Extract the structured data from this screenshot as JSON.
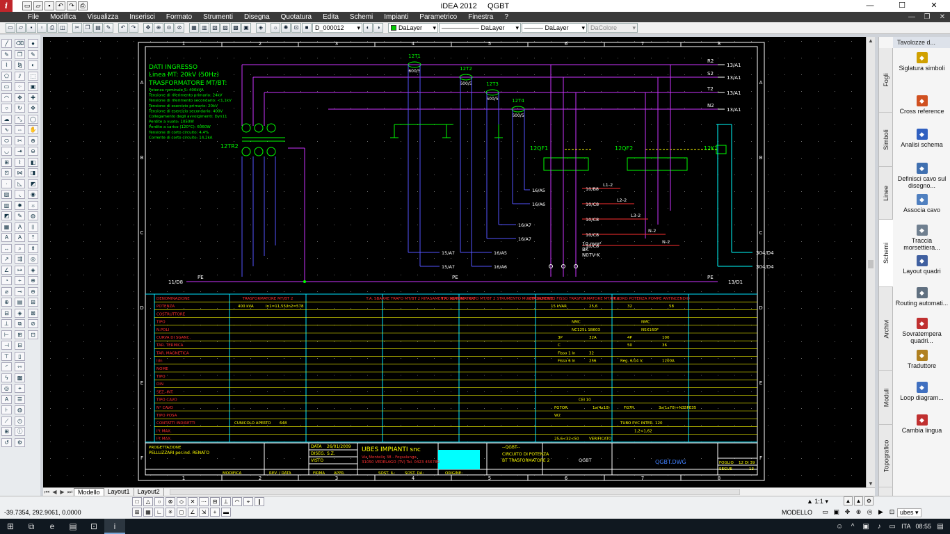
{
  "window": {
    "app_title": "iDEA 2012",
    "doc_title": "QGBT"
  },
  "menu": [
    "File",
    "Modifica",
    "Visualizza",
    "Inserisci",
    "Formato",
    "Strumenti",
    "Disegna",
    "Quotatura",
    "Edita",
    "Schemi",
    "Impianti",
    "Parametrico",
    "Finestra",
    "?"
  ],
  "toolbar": {
    "view_combo": "D_000012",
    "layer_combo": "DaLayer",
    "linetype_combo": "DaLayer",
    "lineweight_combo": "DaLayer",
    "color_combo": "DaColore",
    "accent_color": "#00c800"
  },
  "right_panel": {
    "header": "Tavolozze d...",
    "vertical_tabs": [
      "Fogli",
      "Simboli",
      "Linee",
      "Schemi",
      "Archivi",
      "Moduli",
      "Topografico"
    ],
    "active_tab": "Schemi",
    "tools": [
      {
        "label": "Siglatura simboli",
        "icon": "tag-icon"
      },
      {
        "label": "Cross reference",
        "icon": "cross-reference-icon"
      },
      {
        "label": "Analisi schema",
        "icon": "analysis-icon"
      },
      {
        "label": "Definisci cavo sul disegno...",
        "icon": "cable-define-icon"
      },
      {
        "label": "Associa cavo",
        "icon": "cable-associate-icon"
      },
      {
        "label": "Traccia morsettiera...",
        "icon": "terminal-block-icon"
      },
      {
        "label": "Layout quadri",
        "icon": "panel-layout-icon"
      },
      {
        "label": "Routing automati...",
        "icon": "routing-icon"
      },
      {
        "label": "Sovratempera quadri...",
        "icon": "thermometer-icon"
      },
      {
        "label": "Traduttore",
        "icon": "translator-icon"
      },
      {
        "label": "Loop diagram...",
        "icon": "loop-diagram-icon"
      },
      {
        "label": "Cambia lingua",
        "icon": "language-icon"
      }
    ]
  },
  "layout_tabs": [
    "Modello",
    "Layout1",
    "Layout2"
  ],
  "status": {
    "coordinates": "-39.7354, 292.9061, 0.0000",
    "scale": "1:1",
    "mode": "MODELLO",
    "workspace": "ubes"
  },
  "taskbar": {
    "lang": "ITA",
    "time": "08:55"
  },
  "drawing": {
    "grid_columns": [
      "1",
      "2",
      "3",
      "4",
      "5",
      "6",
      "7",
      "8"
    ],
    "grid_rows": [
      "A",
      "B",
      "C",
      "D",
      "E",
      "F"
    ],
    "data_ingresso": {
      "title": "DATI INGRESSO",
      "line": "Linea MT: 20kV (50Hz)",
      "transformer": "TRASFORMATORE MT/BT:",
      "specs": [
        "Potenza nominale S: 400kVA",
        "Tensione di riferimento primario: 24kV",
        "Tensione di riferimento secondario: <1,1kV",
        "Tensione di esercizio primario: 20kV",
        "Tensione di esercizio secondario: 400V",
        "Collegamento degli avvolgimenti: Dyn11",
        "Perdite a vuoto: 1050W",
        "Perdite a carico (120°C): 6060W",
        "Tensione di corto circuito: 4,4%",
        "Corrente di corto circuito: 14,2kA"
      ]
    },
    "bus_labels": [
      "R2",
      "S2",
      "T2",
      "N2"
    ],
    "bus_refs": [
      "13/A1",
      "13/A1",
      "13/A1",
      "13/A1"
    ],
    "ct_labels": [
      "12T1",
      "12T2",
      "12T3",
      "12T4"
    ],
    "ct_ratios": [
      "600/5",
      "600/5",
      "600/5",
      "600/5"
    ],
    "transformer_tag": "12TR2",
    "breaker_tags": [
      "12QF1",
      "12QF2",
      "12K1"
    ],
    "pe_label": "PE",
    "pe_ref_left": "11/D8",
    "pe_ref_right": "13/D1",
    "outgoing_refs": [
      "10/B8",
      "10/C8",
      "10/C8",
      "10/C8",
      "10/C8"
    ],
    "outgoing_lines": [
      "L1-2",
      "L2-2",
      "L3-2",
      "N-2",
      "N-2"
    ],
    "down_refs": [
      "15/A7",
      "15/A7",
      "16/A5",
      "16/A6",
      "16/A7",
      "16/A7",
      "16/A6",
      "16/A5"
    ],
    "right_refs": [
      "304/D4",
      "304/D4"
    ],
    "cable_note": [
      "10 mm²",
      "BK",
      "N07V-K"
    ],
    "table": {
      "row_labels": [
        "DENOMINAZIONE",
        "POTENZA",
        "COSTRUTTORE",
        "TIPO",
        "N.POLI",
        "CURVA DI SGANC.",
        "TAR. TERMICA",
        "TAR. MAGNETICA",
        "Idn",
        "NOME",
        "TIPO",
        "DIN",
        "SEZ.-INT.",
        "TIPO CAVO",
        "N° CAVO",
        "TIPO POSA",
        "CONTATTI INDIRETTI",
        "I²t MAX.",
        "I²t MAX."
      ],
      "col_heads": [
        "TRASFORMATORE MT/BT 2",
        "T.A. SBARRE TRAFO MT/BT 2 RIFASAMENTO AUTOMATICO",
        "T.A. SBARRE TRAFO MT/BT 2 STRUMENTO MULTIFUNZIONE",
        "RIFASAMENTO FISSO TRASFORMATORE MT/BT 2",
        "QUADRO POTENZA POMPE ANTINCENDIO"
      ],
      "values": [
        "400 kVA",
        "In1=11,55/In2=578",
        "15 kVAR",
        "25,6",
        "32",
        "58",
        "NMC",
        "NMC",
        "NC125L 1B603",
        "NSX160F",
        "3P",
        "32A",
        "4P",
        "100",
        "C",
        "50",
        "36",
        "Fisso 1 In",
        "32",
        "Fisso 6 In",
        "256",
        "Reg. 6/14 Ic",
        "1200A",
        "CEI 10",
        "FG7OR",
        "1x(4x10)",
        "FG7R",
        "3x(1x70)+N35PE35",
        "W2",
        "CUNICOLO APERTO",
        "648",
        "TUBO PVC INTER.",
        "120",
        "VERIFICATO",
        "1,2<1,62",
        "25,6<32<50"
      ]
    },
    "title_block": {
      "progettazione": "PROGETTAZIONE",
      "designer": "PELLUZZARI per.ind. RENATO",
      "data_label": "DATA",
      "data_value": "26/01/2009",
      "diseg_label": "DISEG.",
      "diseg_value": "S.Z.",
      "visto_label": "VISTO",
      "company": "UBES IMPIANTI snc",
      "company_addr1": "Via Montello 38 - Fossalunga",
      "company_addr2": "31050 VEDELAGO (TV) Tel. 0423 456789",
      "doc": "--QGBT--",
      "desc1": "CIRCUITO DI POTENZA",
      "desc2": "BT TRASFORMATORE 2",
      "code": "QGBT",
      "file": "QGBT.DWG",
      "foglio_label": "FOGLIO",
      "foglio_value": "12 DI 39",
      "segue_label": "SEGUE",
      "segue_value": "13",
      "rev_labels": [
        "MODIFICA",
        "REV. / DATA",
        "FIRMA",
        "APPR.",
        "SOST. IL:",
        "SOST. DA:",
        "ORIGINE:"
      ]
    }
  }
}
